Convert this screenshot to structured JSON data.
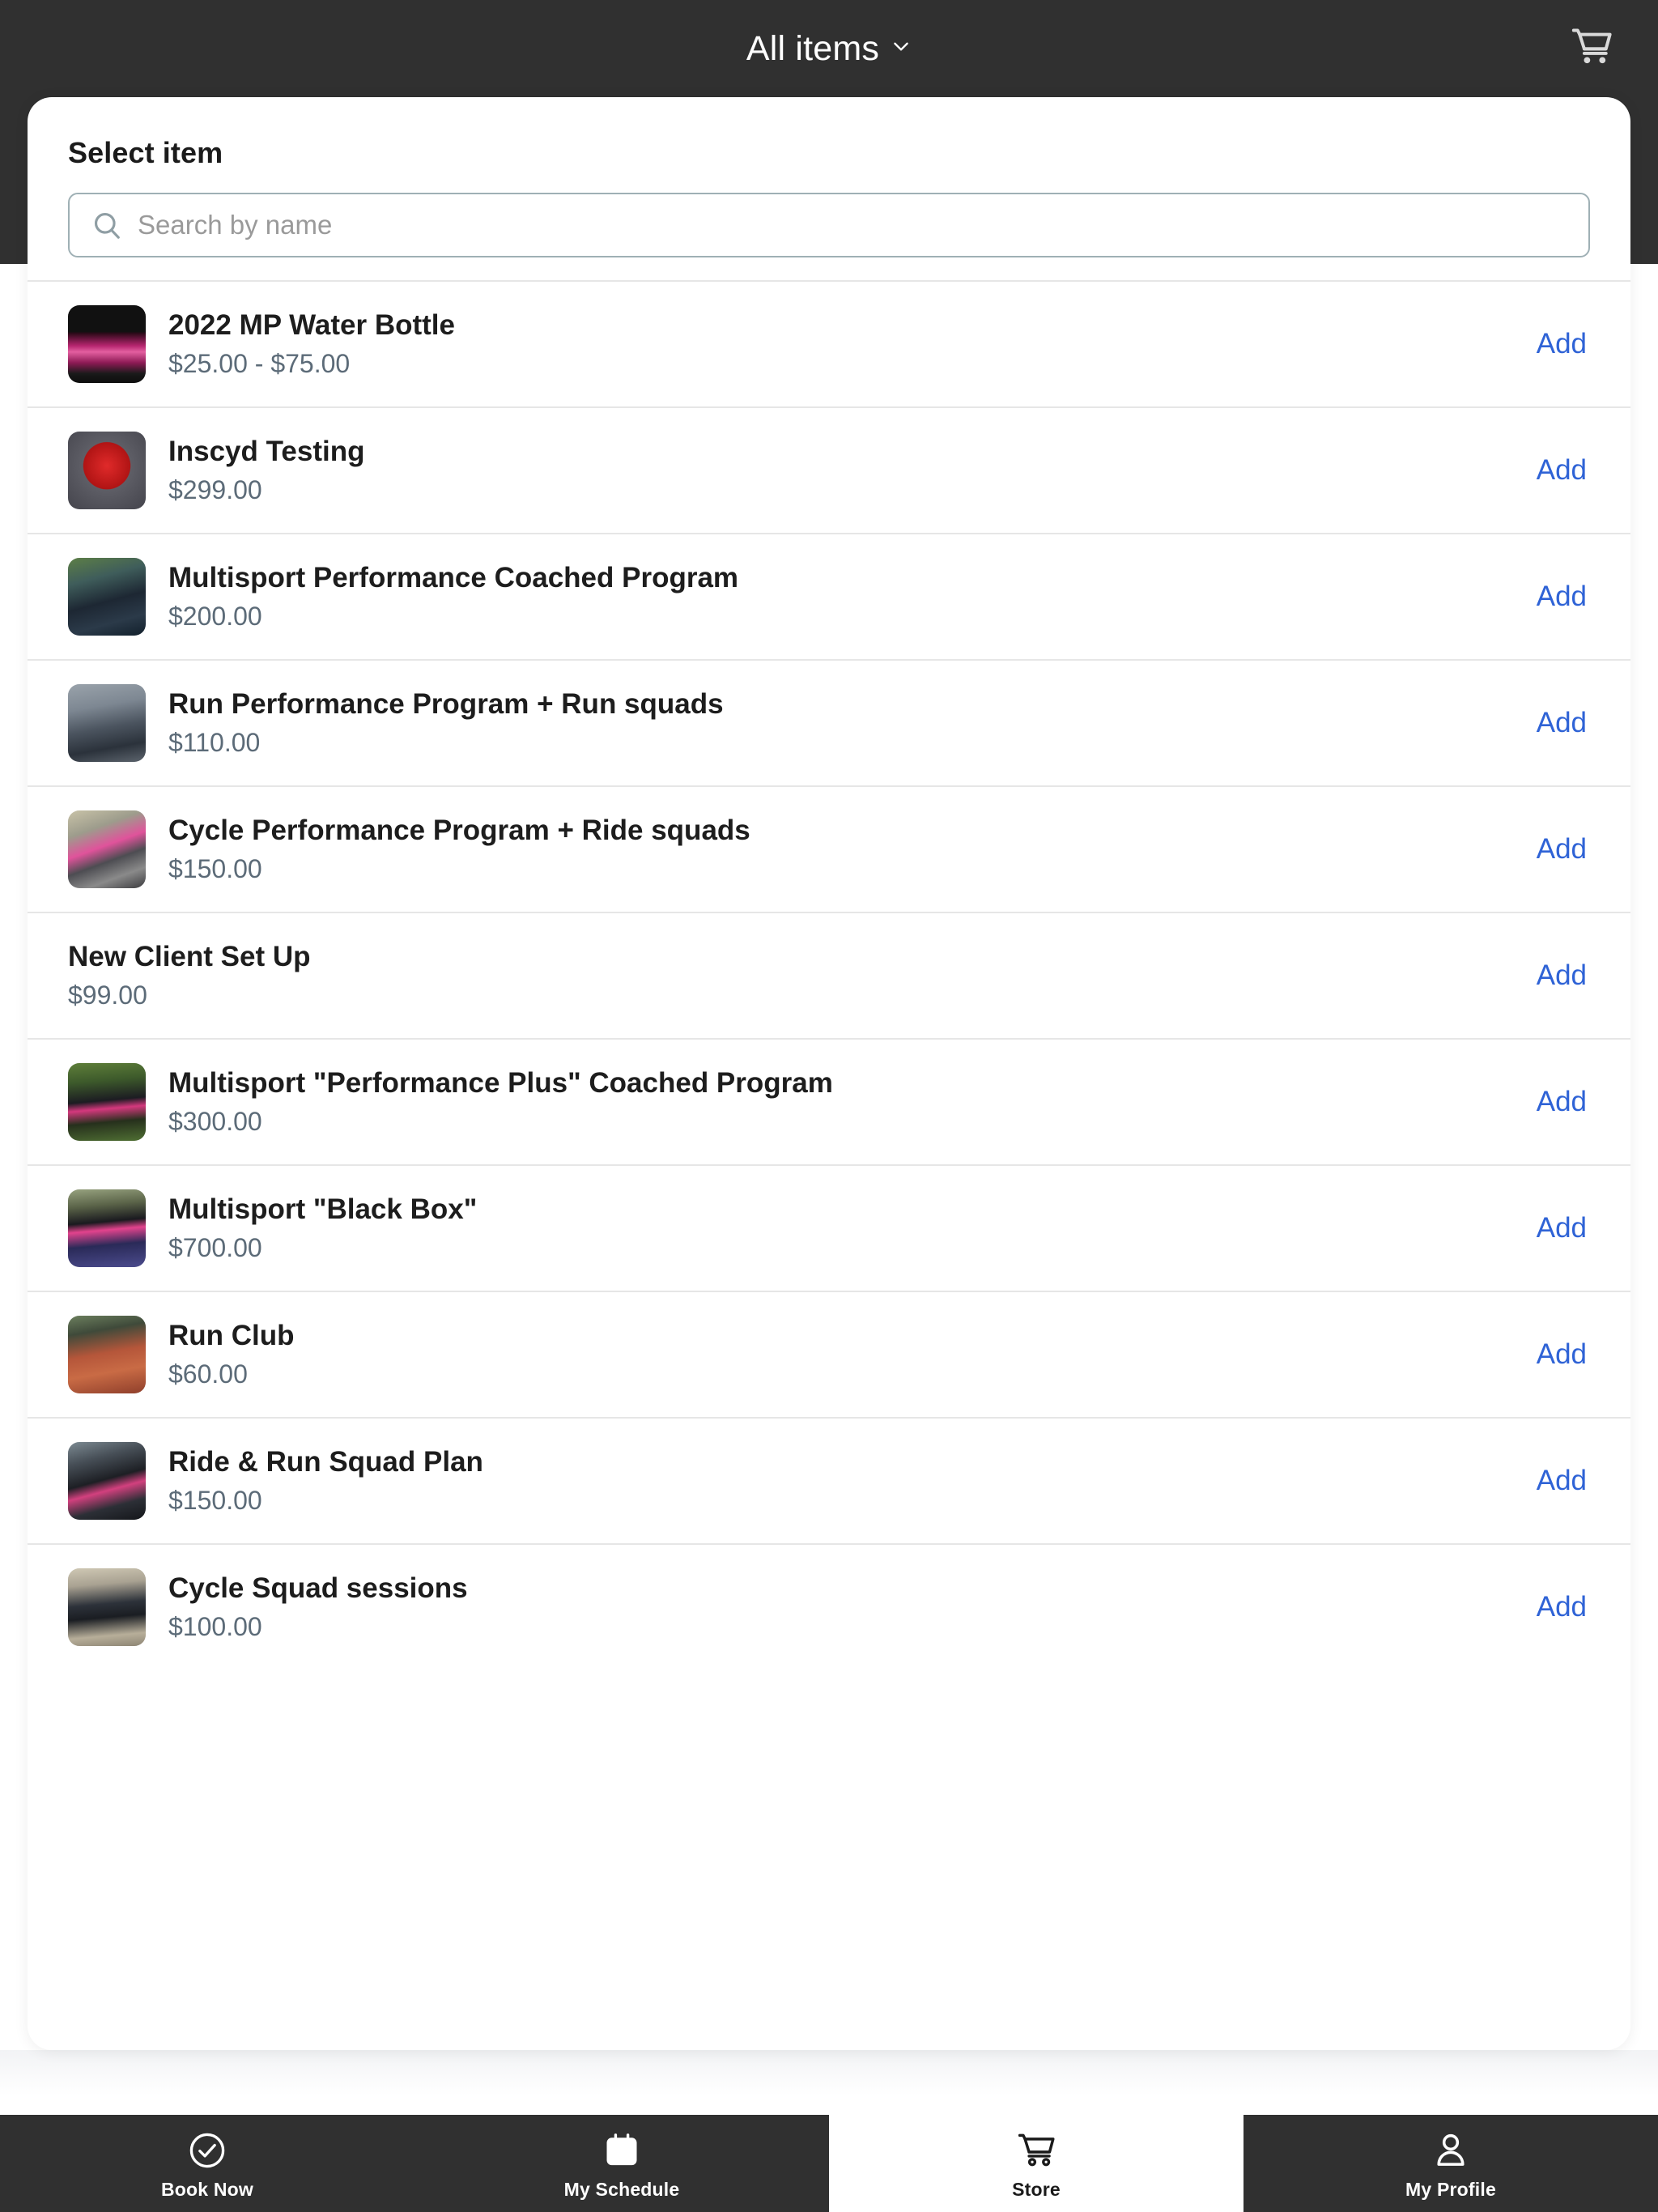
{
  "header": {
    "title": "All items",
    "dropdown_icon": "chevron-down-icon",
    "cart_icon": "shopping-cart-icon",
    "background_color": "#303030"
  },
  "sheet": {
    "title": "Select item",
    "search": {
      "placeholder": "Search by name",
      "value": "",
      "icon": "search-icon"
    }
  },
  "accent_colors": {
    "add_link": "#2f63d6",
    "price_text": "#5c6b78",
    "bar_dark": "#303030"
  },
  "items": [
    {
      "name": "2022 MP Water Bottle",
      "price": "$25.00 - $75.00",
      "add_label": "Add",
      "has_thumb": true,
      "thumb_name": "water-bottle-thumbnail"
    },
    {
      "name": "Inscyd Testing",
      "price": "$299.00",
      "add_label": "Add",
      "has_thumb": true,
      "thumb_name": "inscyd-logo-thumbnail"
    },
    {
      "name": "Multisport Performance Coached Program",
      "price": "$200.00",
      "add_label": "Add",
      "has_thumb": true,
      "thumb_name": "multisport-coached-thumbnail"
    },
    {
      "name": "Run Performance Program + Run squads",
      "price": "$110.00",
      "add_label": "Add",
      "has_thumb": true,
      "thumb_name": "run-performance-thumbnail"
    },
    {
      "name": "Cycle Performance Program + Ride squads",
      "price": "$150.00",
      "add_label": "Add",
      "has_thumb": true,
      "thumb_name": "cycle-performance-thumbnail"
    },
    {
      "name": "New Client Set Up",
      "price": "$99.00",
      "add_label": "Add",
      "has_thumb": false,
      "thumb_name": ""
    },
    {
      "name": "Multisport \"Performance Plus\" Coached Program",
      "price": "$300.00",
      "add_label": "Add",
      "has_thumb": true,
      "thumb_name": "performance-plus-thumbnail"
    },
    {
      "name": "Multisport \"Black Box\"",
      "price": "$700.00",
      "add_label": "Add",
      "has_thumb": true,
      "thumb_name": "black-box-thumbnail"
    },
    {
      "name": "Run Club",
      "price": "$60.00",
      "add_label": "Add",
      "has_thumb": true,
      "thumb_name": "run-club-thumbnail"
    },
    {
      "name": "Ride & Run Squad Plan",
      "price": "$150.00",
      "add_label": "Add",
      "has_thumb": true,
      "thumb_name": "ride-run-squad-thumbnail"
    },
    {
      "name": "Cycle Squad sessions",
      "price": "$100.00",
      "add_label": "Add",
      "has_thumb": true,
      "thumb_name": "cycle-squad-thumbnail"
    }
  ],
  "tabbar": {
    "tabs": [
      {
        "label": "Book Now",
        "icon": "check-circle-icon",
        "active": false
      },
      {
        "label": "My Schedule",
        "icon": "calendar-icon",
        "active": false
      },
      {
        "label": "Store",
        "icon": "shopping-cart-icon",
        "active": true
      },
      {
        "label": "My Profile",
        "icon": "person-icon",
        "active": false
      }
    ]
  }
}
